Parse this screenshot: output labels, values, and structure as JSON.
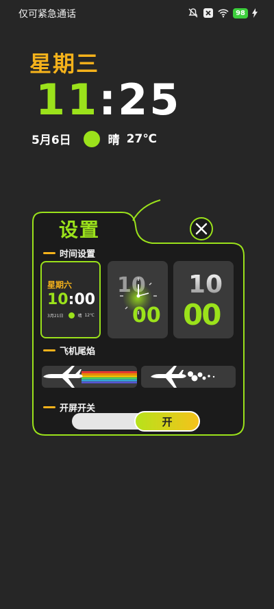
{
  "status_bar": {
    "carrier": "仅可紧急通话",
    "battery": "98",
    "icons": [
      "mute-icon",
      "close-box-icon",
      "wifi-icon",
      "battery-icon",
      "charging-icon"
    ]
  },
  "widget": {
    "weekday": "星期三",
    "hour": "11",
    "separator": ":",
    "minute": "25",
    "date": "5月6日",
    "weather": "晴",
    "temperature": "27℃"
  },
  "panel": {
    "title": "设置",
    "sections": {
      "time": "时间设置",
      "flame": "飞机尾焰",
      "boot": "开屏开关"
    },
    "style1": {
      "weekday": "星期六",
      "hour": "10",
      "minute": "00",
      "separator": ":",
      "date": "3月21日",
      "weather": "晴",
      "temperature": "12℃"
    },
    "style2": {
      "hour": "10",
      "minute": "00"
    },
    "style3": {
      "hour": "10",
      "minute": "00"
    },
    "toggle_label": "开",
    "toggle_on": true
  },
  "colors": {
    "accent_green": "#9be21b",
    "accent_orange": "#f5b21b",
    "background": "#262626",
    "panel": "#1b1b1b"
  }
}
